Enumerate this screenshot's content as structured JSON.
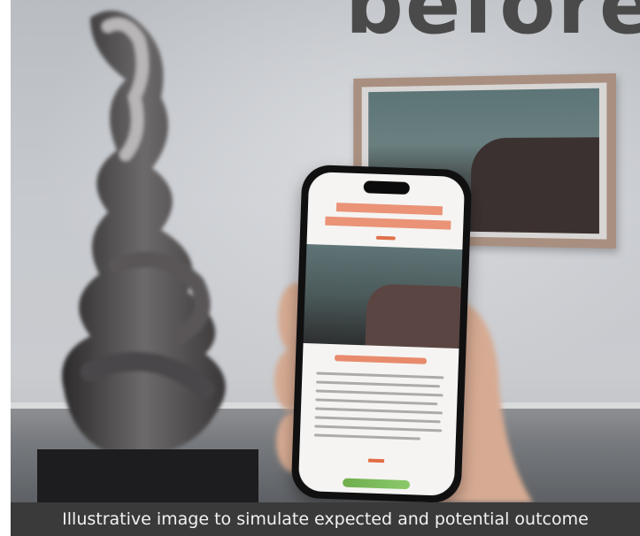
{
  "heading": {
    "text": "before"
  },
  "caption": {
    "text": "Illustrative image to simulate expected and potential outcome"
  },
  "colors": {
    "wall": "#c6c9ce",
    "floor": "#777a7e",
    "heading_text": "#4a4a4a",
    "caption_bar": "#3a3a3a",
    "caption_text": "#f2f2f2",
    "phone_accent": "#e9896a"
  }
}
